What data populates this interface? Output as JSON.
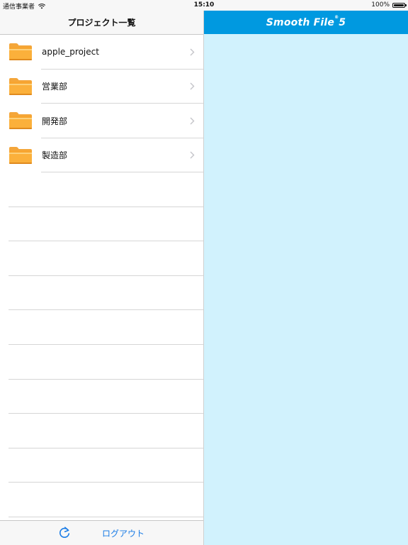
{
  "status": {
    "carrier": "通信事業者",
    "time": "15:10",
    "battery": "100%"
  },
  "nav": {
    "title": "プロジェクト一覧"
  },
  "projects": [
    {
      "label": "apple_project"
    },
    {
      "label": "営業部"
    },
    {
      "label": "開発部"
    },
    {
      "label": "製造部"
    }
  ],
  "toolbar": {
    "logout_label": "ログアウト"
  },
  "brand": {
    "name": "Smooth File",
    "version": "5",
    "bar_color": "#0099e0",
    "pane_color": "#d1f2fd"
  },
  "icons": {
    "wifi": "wifi-icon",
    "folder": "folder-icon",
    "chevron": "chevron-right-icon",
    "refresh": "refresh-icon"
  }
}
